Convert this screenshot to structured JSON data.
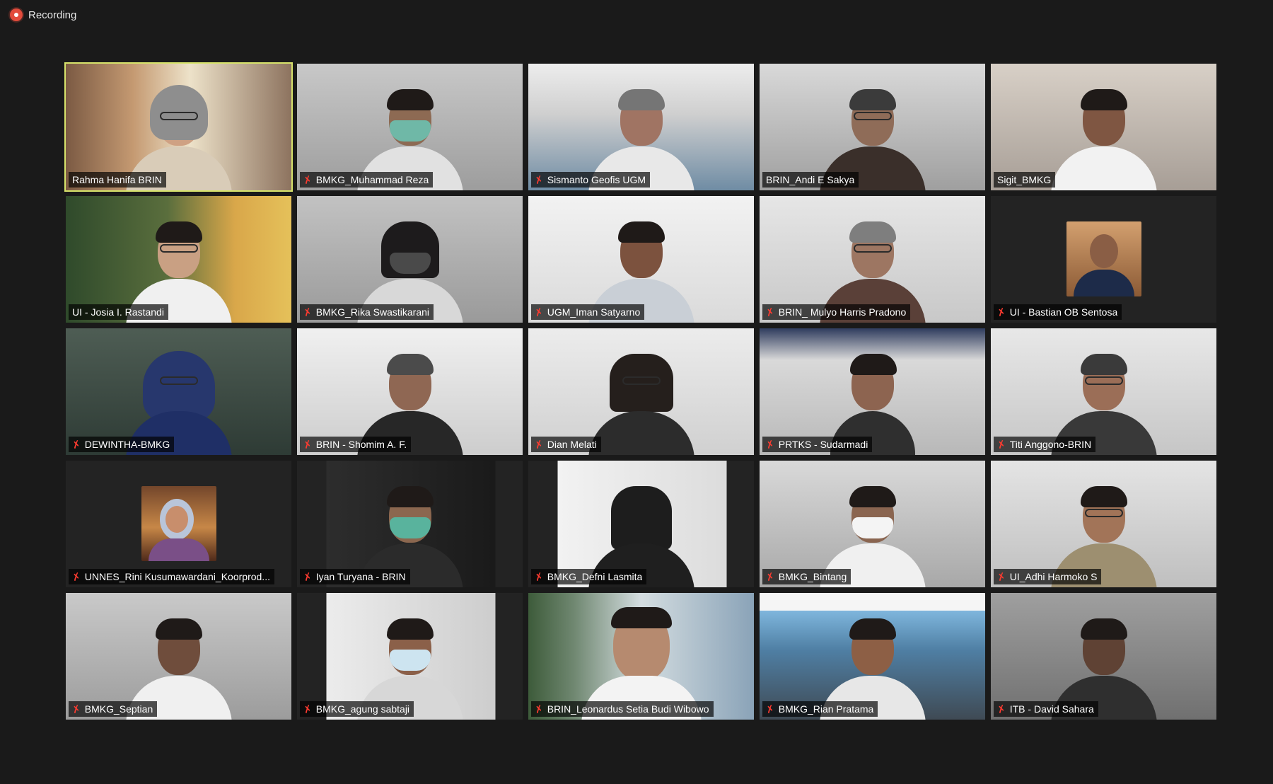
{
  "recording": {
    "label": "Recording",
    "icon": "record-icon",
    "color": "#e24b3b"
  },
  "gallery": {
    "highlight_color": "#d7e36b",
    "participants": [
      {
        "name": "Rahma Hanifa BRIN",
        "muted": false,
        "speaking": true
      },
      {
        "name": "BMKG_Muhammad Reza",
        "muted": true,
        "speaking": false
      },
      {
        "name": "Sismanto Geofis UGM",
        "muted": true,
        "speaking": false
      },
      {
        "name": "BRIN_Andi E Sakya",
        "muted": false,
        "speaking": false
      },
      {
        "name": "Sigit_BMKG",
        "muted": false,
        "speaking": false
      },
      {
        "name": "UI - Josia I. Rastandi",
        "muted": false,
        "speaking": false
      },
      {
        "name": "BMKG_Rika Swastikarani",
        "muted": true,
        "speaking": false
      },
      {
        "name": "UGM_Iman Satyarno",
        "muted": true,
        "speaking": false
      },
      {
        "name": "BRIN_ Mulyo Harris Pradono",
        "muted": true,
        "speaking": false
      },
      {
        "name": "UI - Bastian OB Sentosa",
        "muted": true,
        "speaking": false
      },
      {
        "name": "DEWINTHA-BMKG",
        "muted": true,
        "speaking": false
      },
      {
        "name": "BRIN - Shomim A. F.",
        "muted": true,
        "speaking": false
      },
      {
        "name": "Dian Melati",
        "muted": true,
        "speaking": false
      },
      {
        "name": "PRTKS - Sudarmadi",
        "muted": true,
        "speaking": false
      },
      {
        "name": "Titi Anggono-BRIN",
        "muted": true,
        "speaking": false
      },
      {
        "name": "UNNES_Rini Kusumawardani_Koorprod...",
        "muted": true,
        "speaking": false
      },
      {
        "name": "Iyan Turyana - BRIN",
        "muted": true,
        "speaking": false
      },
      {
        "name": "BMKG_Defni Lasmita",
        "muted": true,
        "speaking": false
      },
      {
        "name": "BMKG_Bintang",
        "muted": true,
        "speaking": false
      },
      {
        "name": "UI_Adhi Harmoko S",
        "muted": true,
        "speaking": false
      },
      {
        "name": "BMKG_Septian",
        "muted": true,
        "speaking": false
      },
      {
        "name": "BMKG_agung sabtaji",
        "muted": true,
        "speaking": false
      },
      {
        "name": "BRIN_Leonardus Setia Budi Wibowo",
        "muted": true,
        "speaking": false
      },
      {
        "name": "BMKG_Rian Pratama",
        "muted": true,
        "speaking": false
      },
      {
        "name": "ITB - David Sahara",
        "muted": true,
        "speaking": false
      }
    ]
  }
}
